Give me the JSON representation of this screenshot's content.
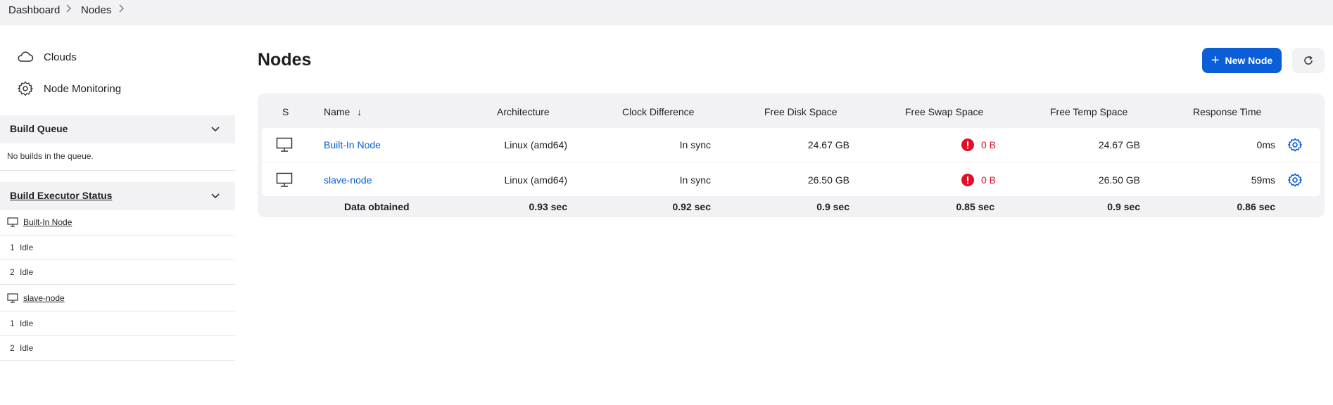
{
  "breadcrumb": {
    "items": [
      "Dashboard",
      "Nodes"
    ]
  },
  "sidebar": {
    "links": [
      {
        "label": "Clouds",
        "icon": "cloud-icon"
      },
      {
        "label": "Node Monitoring",
        "icon": "gear-icon"
      }
    ],
    "build_queue": {
      "title": "Build Queue",
      "empty_text": "No builds in the queue."
    },
    "executor_status": {
      "title": "Build Executor Status",
      "nodes": [
        {
          "name": "Built-In Node",
          "executors": [
            {
              "num": "1",
              "status": "Idle"
            },
            {
              "num": "2",
              "status": "Idle"
            }
          ]
        },
        {
          "name": "slave-node",
          "executors": [
            {
              "num": "1",
              "status": "Idle"
            },
            {
              "num": "2",
              "status": "Idle"
            }
          ]
        }
      ]
    }
  },
  "main": {
    "title": "Nodes",
    "new_node_label": "New Node",
    "accent_color": "#0b5ed7",
    "warning_color": "#e0102b"
  },
  "table": {
    "headers": {
      "status": "S",
      "name": "Name",
      "sort_indicator": "↓",
      "architecture": "Architecture",
      "clock": "Clock Difference",
      "disk": "Free Disk Space",
      "swap": "Free Swap Space",
      "temp": "Free Temp Space",
      "response": "Response Time"
    },
    "rows": [
      {
        "name": "Built-In Node",
        "architecture": "Linux (amd64)",
        "clock": "In sync",
        "disk": "24.67 GB",
        "swap": "0 B",
        "temp": "24.67 GB",
        "response": "0ms"
      },
      {
        "name": "slave-node",
        "architecture": "Linux (amd64)",
        "clock": "In sync",
        "disk": "26.50 GB",
        "swap": "0 B",
        "temp": "26.50 GB",
        "response": "59ms"
      }
    ],
    "footer": {
      "label": "Data obtained",
      "architecture": "0.93 sec",
      "clock": "0.92 sec",
      "disk": "0.9 sec",
      "swap": "0.85 sec",
      "temp": "0.9 sec",
      "response": "0.86 sec"
    }
  }
}
